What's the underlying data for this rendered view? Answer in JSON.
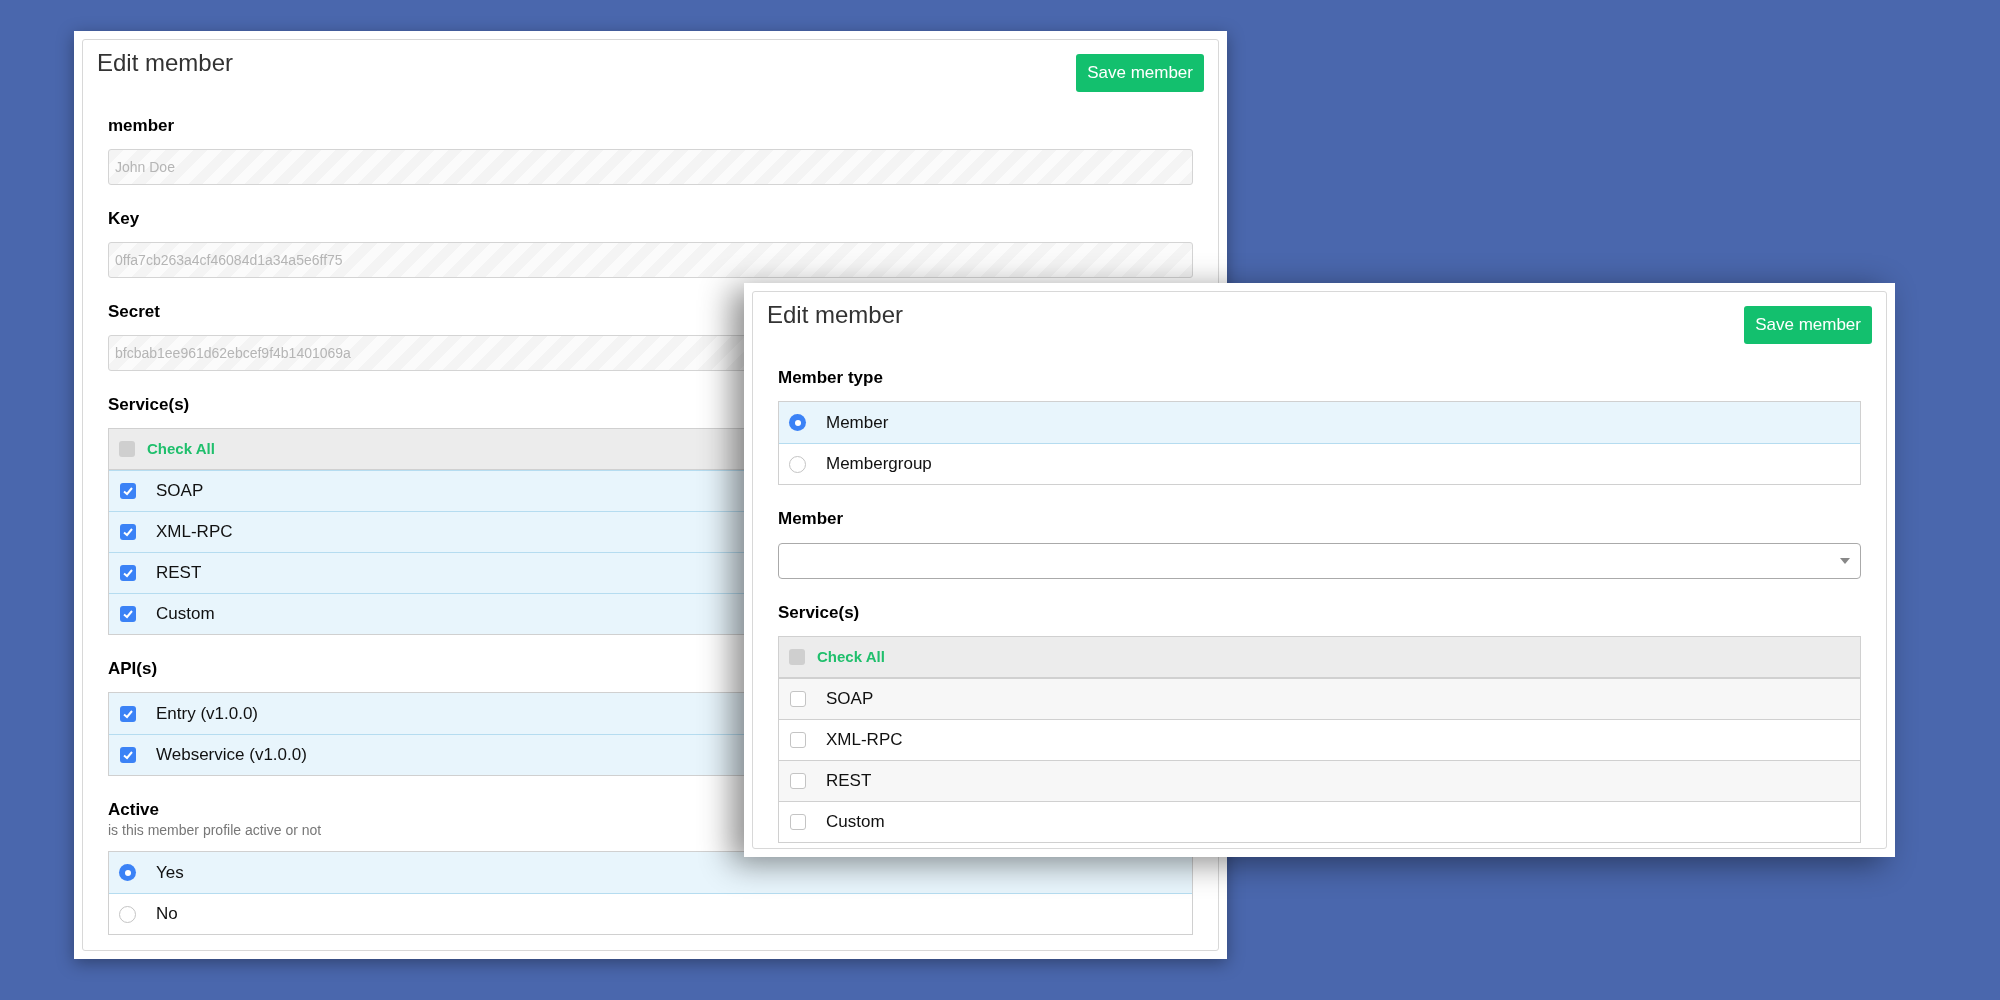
{
  "windows": [
    {
      "title": "Edit member",
      "save_button": "Save member",
      "sections": [
        {
          "kind": "text_field",
          "label": "member",
          "value": "John Doe",
          "disabled": true
        },
        {
          "kind": "text_field",
          "label": "Key",
          "value": "0ffa7cb263a4cf46084d1a34a5e6ff75",
          "disabled": true
        },
        {
          "kind": "text_field",
          "label": "Secret",
          "value": "bfcbab1ee961d62ebcef9f4b1401069a",
          "disabled": true
        },
        {
          "kind": "checklist",
          "label": "Service(s)",
          "check_all": {
            "label": "Check All",
            "checked": false
          },
          "items": [
            {
              "label": "SOAP",
              "checked": true
            },
            {
              "label": "XML-RPC",
              "checked": true
            },
            {
              "label": "REST",
              "checked": true
            },
            {
              "label": "Custom",
              "checked": true
            }
          ]
        },
        {
          "kind": "checklist",
          "label": "API(s)",
          "items": [
            {
              "label": "Entry (v1.0.0)",
              "checked": true
            },
            {
              "label": "Webservice (v1.0.0)",
              "checked": true
            }
          ]
        },
        {
          "kind": "radio",
          "label": "Active",
          "hint": "is this member profile active or not",
          "options": [
            {
              "label": "Yes",
              "selected": true
            },
            {
              "label": "No",
              "selected": false
            }
          ]
        }
      ]
    },
    {
      "title": "Edit member",
      "save_button": "Save member",
      "sections": [
        {
          "kind": "radio",
          "label": "Member type",
          "options": [
            {
              "label": "Member",
              "selected": true
            },
            {
              "label": "Membergroup",
              "selected": false
            }
          ]
        },
        {
          "kind": "select",
          "label": "Member"
        },
        {
          "kind": "checklist",
          "label": "Service(s)",
          "check_all": {
            "label": "Check All",
            "checked": false
          },
          "items": [
            {
              "label": "SOAP",
              "checked": false
            },
            {
              "label": "XML-RPC",
              "checked": false
            },
            {
              "label": "REST",
              "checked": false
            },
            {
              "label": "Custom",
              "checked": false
            }
          ]
        }
      ]
    }
  ]
}
